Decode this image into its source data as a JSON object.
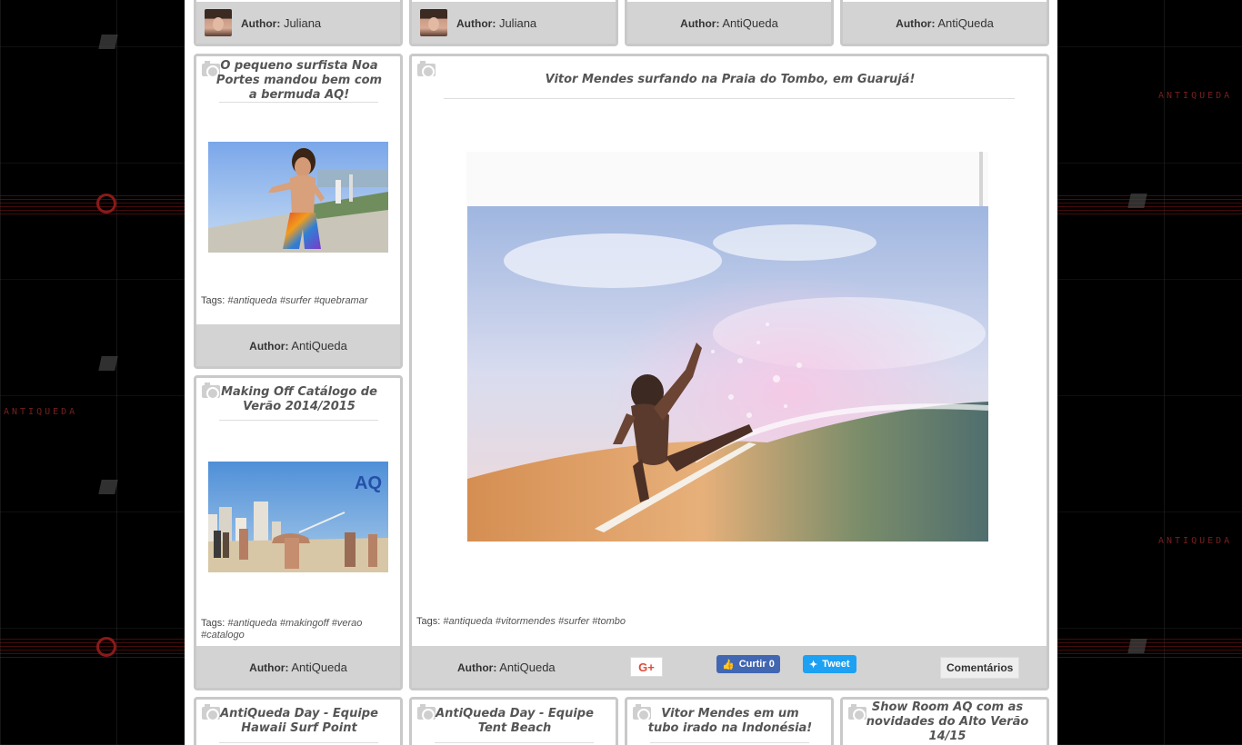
{
  "page": {
    "background_color": "#000000",
    "accent_color": "#7a1f1f",
    "watermark_text": "ANTIQUEDA"
  },
  "top_row": [
    {
      "author_key": "Author:",
      "author_name": "Juliana",
      "has_avatar": true
    },
    {
      "author_key": "Author:",
      "author_name": "Juliana",
      "has_avatar": true
    },
    {
      "author_key": "Author:",
      "author_name": "AntiQueda",
      "has_avatar": false
    },
    {
      "author_key": "Author:",
      "author_name": "AntiQueda",
      "has_avatar": false
    }
  ],
  "posts": [
    {
      "title": "O pequeno surfista Noa Portes mandou bem com a bermuda AQ!",
      "tags_label": "Tags:",
      "tags": [
        "#antiqueda",
        "#surfer",
        "#quebramar"
      ],
      "author_key": "Author:",
      "author_name": "AntiQueda"
    },
    {
      "title": "Making Off Catálogo de Verão 2014/2015",
      "tags_label": "Tags:",
      "tags": [
        "#antiqueda",
        "#makingoff",
        "#verao",
        "#catalogo"
      ],
      "author_key": "Author:",
      "author_name": "AntiQueda",
      "image_logo": "AQ"
    }
  ],
  "featured": {
    "title": "Vitor Mendes surfando na Praia do Tombo, em Guarujá!",
    "tags_label": "Tags:",
    "tags": [
      "#antiqueda",
      "#vitormendes",
      "#surfer",
      "#tombo"
    ],
    "author_key": "Author:",
    "author_name": "AntiQueda",
    "share": {
      "gplus_label": "G+",
      "facebook_label": "Curtir 0",
      "twitter_label": "Tweet",
      "comments_label": "Comentários"
    }
  },
  "bottom_row": [
    {
      "title": "AntiQueda Day - Equipe Hawaii Surf Point"
    },
    {
      "title": "AntiQueda Day - Equipe Tent Beach"
    },
    {
      "title": "Vitor Mendes em um tubo irado na Indonésia!"
    },
    {
      "title": "Show Room AQ com as novidades do Alto Verão 14/15"
    }
  ],
  "icons": {
    "camera": "camera-icon",
    "facebook_like": "thumbs-up-icon",
    "twitter": "twitter-bird-icon"
  }
}
